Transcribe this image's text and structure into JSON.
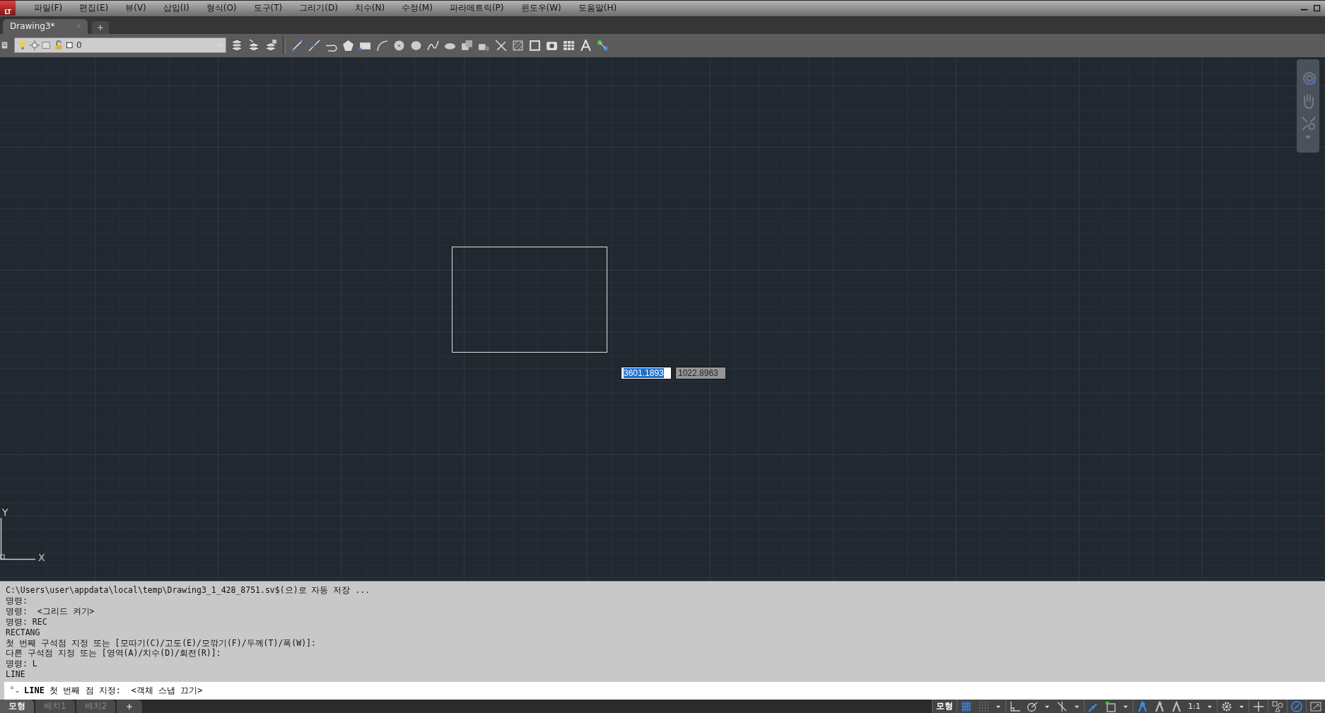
{
  "app_logo": "LT",
  "menu": [
    "파일(F)",
    "편집(E)",
    "뷰(V)",
    "삽입(I)",
    "형식(O)",
    "도구(T)",
    "그리기(D)",
    "치수(N)",
    "수정(M)",
    "파라메트릭(P)",
    "윈도우(W)",
    "도움말(H)"
  ],
  "file_tabs": [
    {
      "label": "Drawing3*",
      "selected": true
    }
  ],
  "layer": {
    "name": "0"
  },
  "canvas": {
    "coordinates": [
      {
        "value": "3601.1893",
        "selected": true
      },
      {
        "value": "1022.8963",
        "selected": false
      }
    ],
    "ucs": {
      "y": "Y",
      "x": "X"
    },
    "navbar": {
      "badge": "2D"
    }
  },
  "command_history": [
    "C:\\Users\\user\\appdata\\local\\temp\\Drawing3_1_428_8751.sv$(으)로 자동 저장 ...",
    "명령:",
    "명령:  <그리드 켜기>",
    "명령: REC",
    "RECTANG",
    "첫 번째 구석점 지정 또는 [모따기(C)/고도(E)/모깎기(F)/두께(T)/폭(W)]:",
    "다른 구석점 지정 또는 [영역(A)/치수(D)/회전(R)]:",
    "명령: L",
    "LINE"
  ],
  "command_line": "**LINE** 첫 번째 점 지정:  <객체 스냅 끄기>",
  "layout_tabs": [
    {
      "label": "모형",
      "selected": true
    },
    {
      "label": "배치1",
      "selected": false
    },
    {
      "label": "배치2",
      "selected": false
    }
  ],
  "status_bar": {
    "space": "모형",
    "scale": "1:1"
  }
}
